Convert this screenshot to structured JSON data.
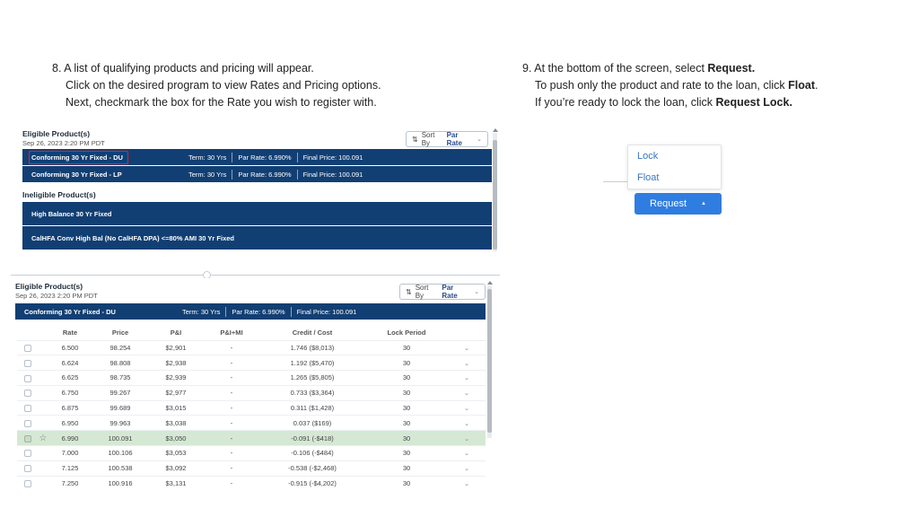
{
  "step8": {
    "number": "8.",
    "line1": "A list of qualifying products and pricing will appear.",
    "line2": "Click on the desired program to view Rates and Pricing options.",
    "line3": "Next, checkmark the box for the Rate you wish to register with."
  },
  "step9": {
    "number": "9.",
    "line1_pre": "At the bottom of the screen, select ",
    "line1_bold": "Request.",
    "line2_pre": "To push only the product and rate to the loan, click ",
    "line2_bold": "Float",
    "line2_post": ".",
    "line3_pre": "If you’re ready to lock the loan, click ",
    "line3_bold": "Request Lock."
  },
  "panel1": {
    "title": "Eligible Product(s)",
    "date": "Sep 26, 2023 2:20 PM PDT",
    "sort_prefix": "Sort By",
    "sort_value": "Par Rate",
    "eligible": [
      {
        "name": "Conforming 30 Yr Fixed - DU",
        "term": "Term: 30 Yrs",
        "par": "Par Rate: 6.990%",
        "price": "Final Price: 100.091"
      },
      {
        "name": "Conforming 30 Yr Fixed - LP",
        "term": "Term: 30 Yrs",
        "par": "Par Rate: 6.990%",
        "price": "Final Price: 100.091"
      }
    ],
    "ineligible_title": "Ineligible Product(s)",
    "ineligible": [
      {
        "name": "High Balance 30 Yr Fixed"
      },
      {
        "name": "CalHFA Conv High Bal (No CalHFA DPA) <=80% AMI 30 Yr Fixed"
      }
    ]
  },
  "panel2": {
    "title": "Eligible Product(s)",
    "date": "Sep 26, 2023 2:20 PM PDT",
    "sort_prefix": "Sort By",
    "sort_value": "Par Rate",
    "product": {
      "name": "Conforming 30 Yr Fixed - DU",
      "term": "Term: 30 Yrs",
      "par": "Par Rate: 6.990%",
      "price": "Final Price: 100.091"
    },
    "columns": [
      "Rate",
      "Price",
      "P&I",
      "P&I+MI",
      "Credit / Cost",
      "Lock Period"
    ],
    "rows": [
      {
        "rate": "6.500",
        "price": "98.254",
        "pi": "$2,901",
        "pimi": "-",
        "credit": "1.746 ($8,013)",
        "lock": "30"
      },
      {
        "rate": "6.624",
        "price": "98.808",
        "pi": "$2,938",
        "pimi": "-",
        "credit": "1.192 ($5,470)",
        "lock": "30"
      },
      {
        "rate": "6.625",
        "price": "98.735",
        "pi": "$2,939",
        "pimi": "-",
        "credit": "1.265 ($5,805)",
        "lock": "30"
      },
      {
        "rate": "6.750",
        "price": "99.267",
        "pi": "$2,977",
        "pimi": "-",
        "credit": "0.733 ($3,364)",
        "lock": "30"
      },
      {
        "rate": "6.875",
        "price": "99.689",
        "pi": "$3,015",
        "pimi": "-",
        "credit": "0.311 ($1,428)",
        "lock": "30"
      },
      {
        "rate": "6.950",
        "price": "99.963",
        "pi": "$3,038",
        "pimi": "-",
        "credit": "0.037 ($169)",
        "lock": "30"
      },
      {
        "rate": "6.990",
        "price": "100.091",
        "pi": "$3,050",
        "pimi": "-",
        "credit": "-0.091 (-$418)",
        "lock": "30",
        "selected": true
      },
      {
        "rate": "7.000",
        "price": "100.106",
        "pi": "$3,053",
        "pimi": "-",
        "credit": "-0.106 (-$484)",
        "lock": "30"
      },
      {
        "rate": "7.125",
        "price": "100.538",
        "pi": "$3,092",
        "pimi": "-",
        "credit": "-0.538 (-$2,468)",
        "lock": "30"
      },
      {
        "rate": "7.250",
        "price": "100.916",
        "pi": "$3,131",
        "pimi": "-",
        "credit": "-0.915 (-$4,202)",
        "lock": "30"
      }
    ]
  },
  "request_menu": {
    "lock_label": "Lock",
    "float_label": "Float",
    "request_label": "Request",
    "caret": "▲"
  },
  "colors": {
    "bar": "#123f73",
    "selected_row": "#d5e8d4",
    "button": "#2f7de1",
    "highlight": "#d3243a"
  }
}
